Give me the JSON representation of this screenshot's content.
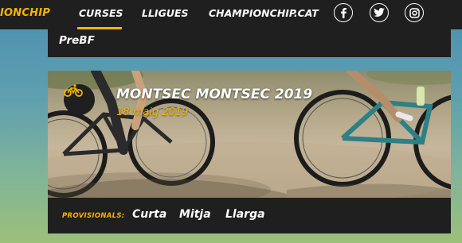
{
  "header": {
    "brand": "IONCHIP",
    "nav": [
      {
        "label": "CURSES",
        "active": true
      },
      {
        "label": "LLIGUES",
        "active": false
      },
      {
        "label": "CHAMPIONCHIP.CAT",
        "active": false
      }
    ],
    "social_icons": [
      "facebook-icon",
      "twitter-icon",
      "instagram-icon"
    ],
    "accent_color": "#f5b400",
    "bar_color": "#1f1f1f"
  },
  "previous_event": {
    "title": "PreBF"
  },
  "event": {
    "badge_icon": "bicycle-icon",
    "title": "MONTSEC MONTSEC 2019",
    "date": "18 maig 2019",
    "results_label": "PROVISIONALS:",
    "results": [
      "Curta",
      "Mitja",
      "Llarga"
    ]
  }
}
